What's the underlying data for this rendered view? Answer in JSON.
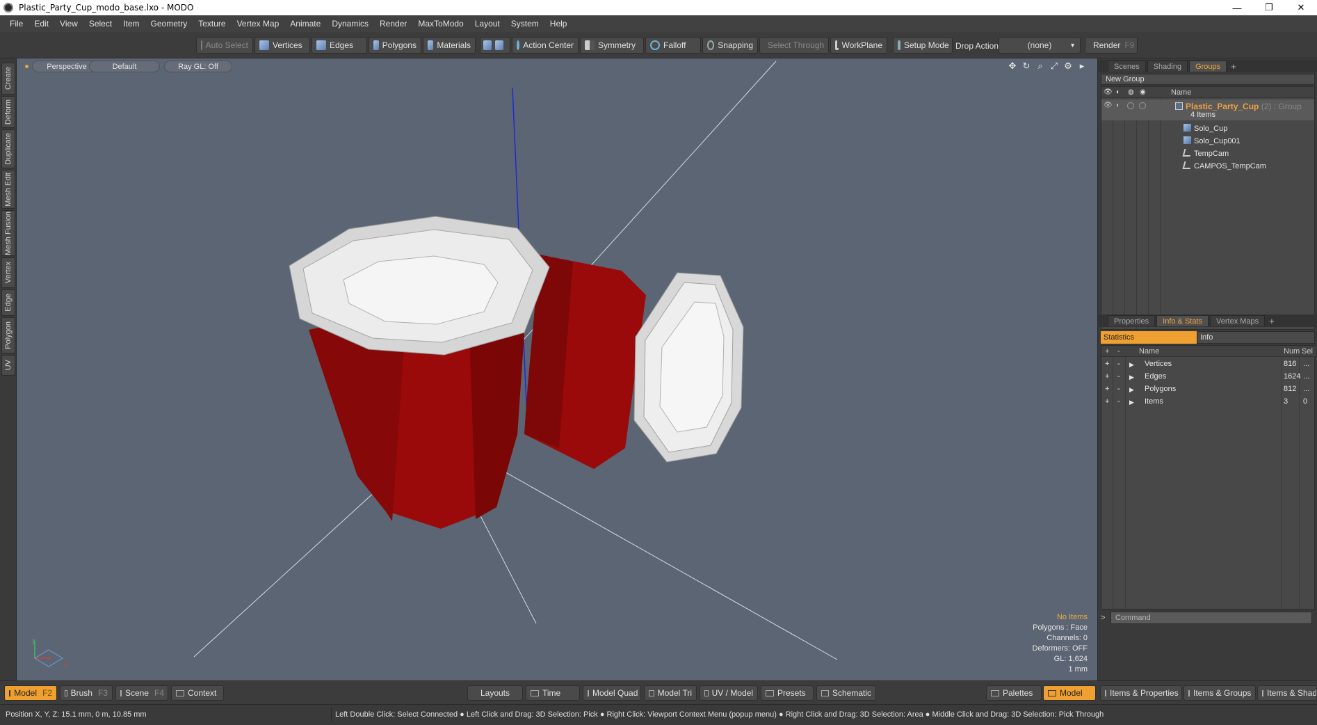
{
  "window": {
    "title": "Plastic_Party_Cup_modo_base.lxo - MODO",
    "minimize_glyph": "—",
    "restore_glyph": "❐",
    "close_glyph": "✕"
  },
  "menu": [
    "File",
    "Edit",
    "View",
    "Select",
    "Item",
    "Geometry",
    "Texture",
    "Vertex Map",
    "Animate",
    "Dynamics",
    "Render",
    "MaxToModo",
    "Layout",
    "System",
    "Help"
  ],
  "toolbar": {
    "auto_select": "Auto Select",
    "vertices": "Vertices",
    "edges": "Edges",
    "polygons": "Polygons",
    "materials": "Materials",
    "action_center": "Action Center",
    "symmetry": "Symmetry",
    "falloff": "Falloff",
    "snapping": "Snapping",
    "select_through": "Select Through",
    "workplane": "WorkPlane",
    "setup_mode": "Setup Mode",
    "drop_action_label": "Drop Action",
    "drop_action_value": "(none)",
    "render": "Render",
    "render_key": "F9"
  },
  "left_tabs": [
    "Create",
    "Deform",
    "Duplicate",
    "Mesh Edit",
    "Mesh Fusion",
    "Vertex",
    "Edge",
    "Polygon",
    "UV"
  ],
  "viewport": {
    "view": "Perspective",
    "shading": "Default",
    "raygl": "Ray GL: Off",
    "info": {
      "items": "No Items",
      "polygons": "Polygons : Face",
      "channels": "Channels: 0",
      "deformers": "Deformers: OFF",
      "gl": "GL: 1,624",
      "unit": "1 mm"
    },
    "axis_x": "x",
    "axis_y": "y",
    "cup_color": "#9b0a0a",
    "background_color": "#5c6573"
  },
  "scene_panel": {
    "tabs": [
      "Scenes",
      "Shading",
      "Groups"
    ],
    "active_tab": "Groups",
    "new_group": "New Group",
    "name_header": "Name",
    "group": {
      "name": "Plastic_Party_Cup",
      "suffix": "(2) : Group",
      "count": "4 Items"
    },
    "items": [
      {
        "label": "Solo_Cup",
        "icon": "mesh-icon"
      },
      {
        "label": "Solo_Cup001",
        "icon": "mesh-icon"
      },
      {
        "label": "TempCam",
        "icon": "camera-icon"
      },
      {
        "label": "CAMPOS_TempCam",
        "icon": "camera-icon"
      }
    ]
  },
  "info_panel": {
    "tabs": [
      "Properties",
      "Info & Stats",
      "Vertex Maps"
    ],
    "active_tab": "Info & Stats",
    "subtabs": [
      "Statistics",
      "Info"
    ],
    "headers": {
      "name": "Name",
      "num": "Num",
      "sel": "Sel"
    },
    "rows": [
      {
        "name": "Vertices",
        "num": "816",
        "sel": "..."
      },
      {
        "name": "Edges",
        "num": "1624",
        "sel": "..."
      },
      {
        "name": "Polygons",
        "num": "812",
        "sel": "..."
      },
      {
        "name": "Items",
        "num": "3",
        "sel": "0"
      }
    ],
    "command_placeholder": "Command"
  },
  "bottom_bar": {
    "model": "Model",
    "model_key": "F2",
    "brush": "Brush",
    "brush_key": "F3",
    "scene": "Scene",
    "scene_key": "F4",
    "context": "Context",
    "layouts": "Layouts",
    "time": "Time",
    "model_quad": "Model Quad",
    "model_tri": "Model Tri",
    "uv_model": "UV / Model",
    "presets": "Presets",
    "schematic": "Schematic",
    "palettes": "Palettes",
    "model_right": "Model",
    "items_properties": "Items & Properties",
    "items_groups": "Items & Groups",
    "items_shading": "Items & Shadi"
  },
  "status": {
    "position": "Position X, Y, Z:   15.1 mm, 0 m, 10.85 mm",
    "hints": "Left Double Click: Select Connected ● Left Click and Drag: 3D Selection: Pick ● Right Click: Viewport Context Menu (popup menu) ● Right Click and Drag: 3D Selection: Area ● Middle Click and Drag: 3D Selection: Pick Through"
  }
}
